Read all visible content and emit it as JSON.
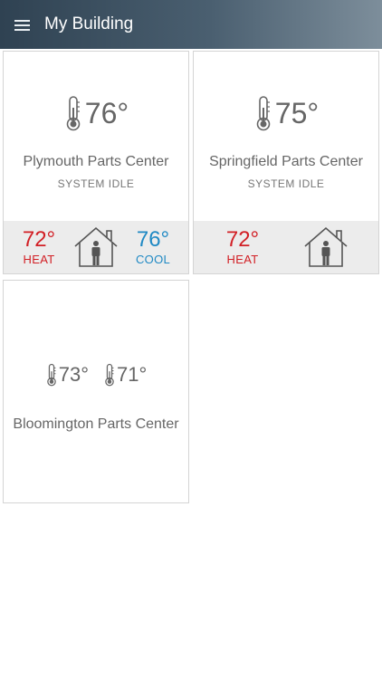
{
  "header": {
    "title": "My Building",
    "menu_icon": "hamburger-menu-icon"
  },
  "colors": {
    "heat": "#d21f25",
    "cool": "#1f89c4",
    "appbar": "#3d5163"
  },
  "cards": [
    {
      "temperature": "76°",
      "name": "Plymouth Parts Center",
      "status": "SYSTEM IDLE",
      "heat_setpoint": "72°",
      "heat_label": "HEAT",
      "cool_setpoint": "76°",
      "cool_label": "COOL"
    },
    {
      "temperature": "75°",
      "name": "Springfield Parts Center",
      "status": "SYSTEM IDLE",
      "heat_setpoint": "72°",
      "heat_label": "HEAT"
    },
    {
      "temperature_1": "73°",
      "temperature_2": "71°",
      "name": "Bloomington Parts Center"
    }
  ]
}
